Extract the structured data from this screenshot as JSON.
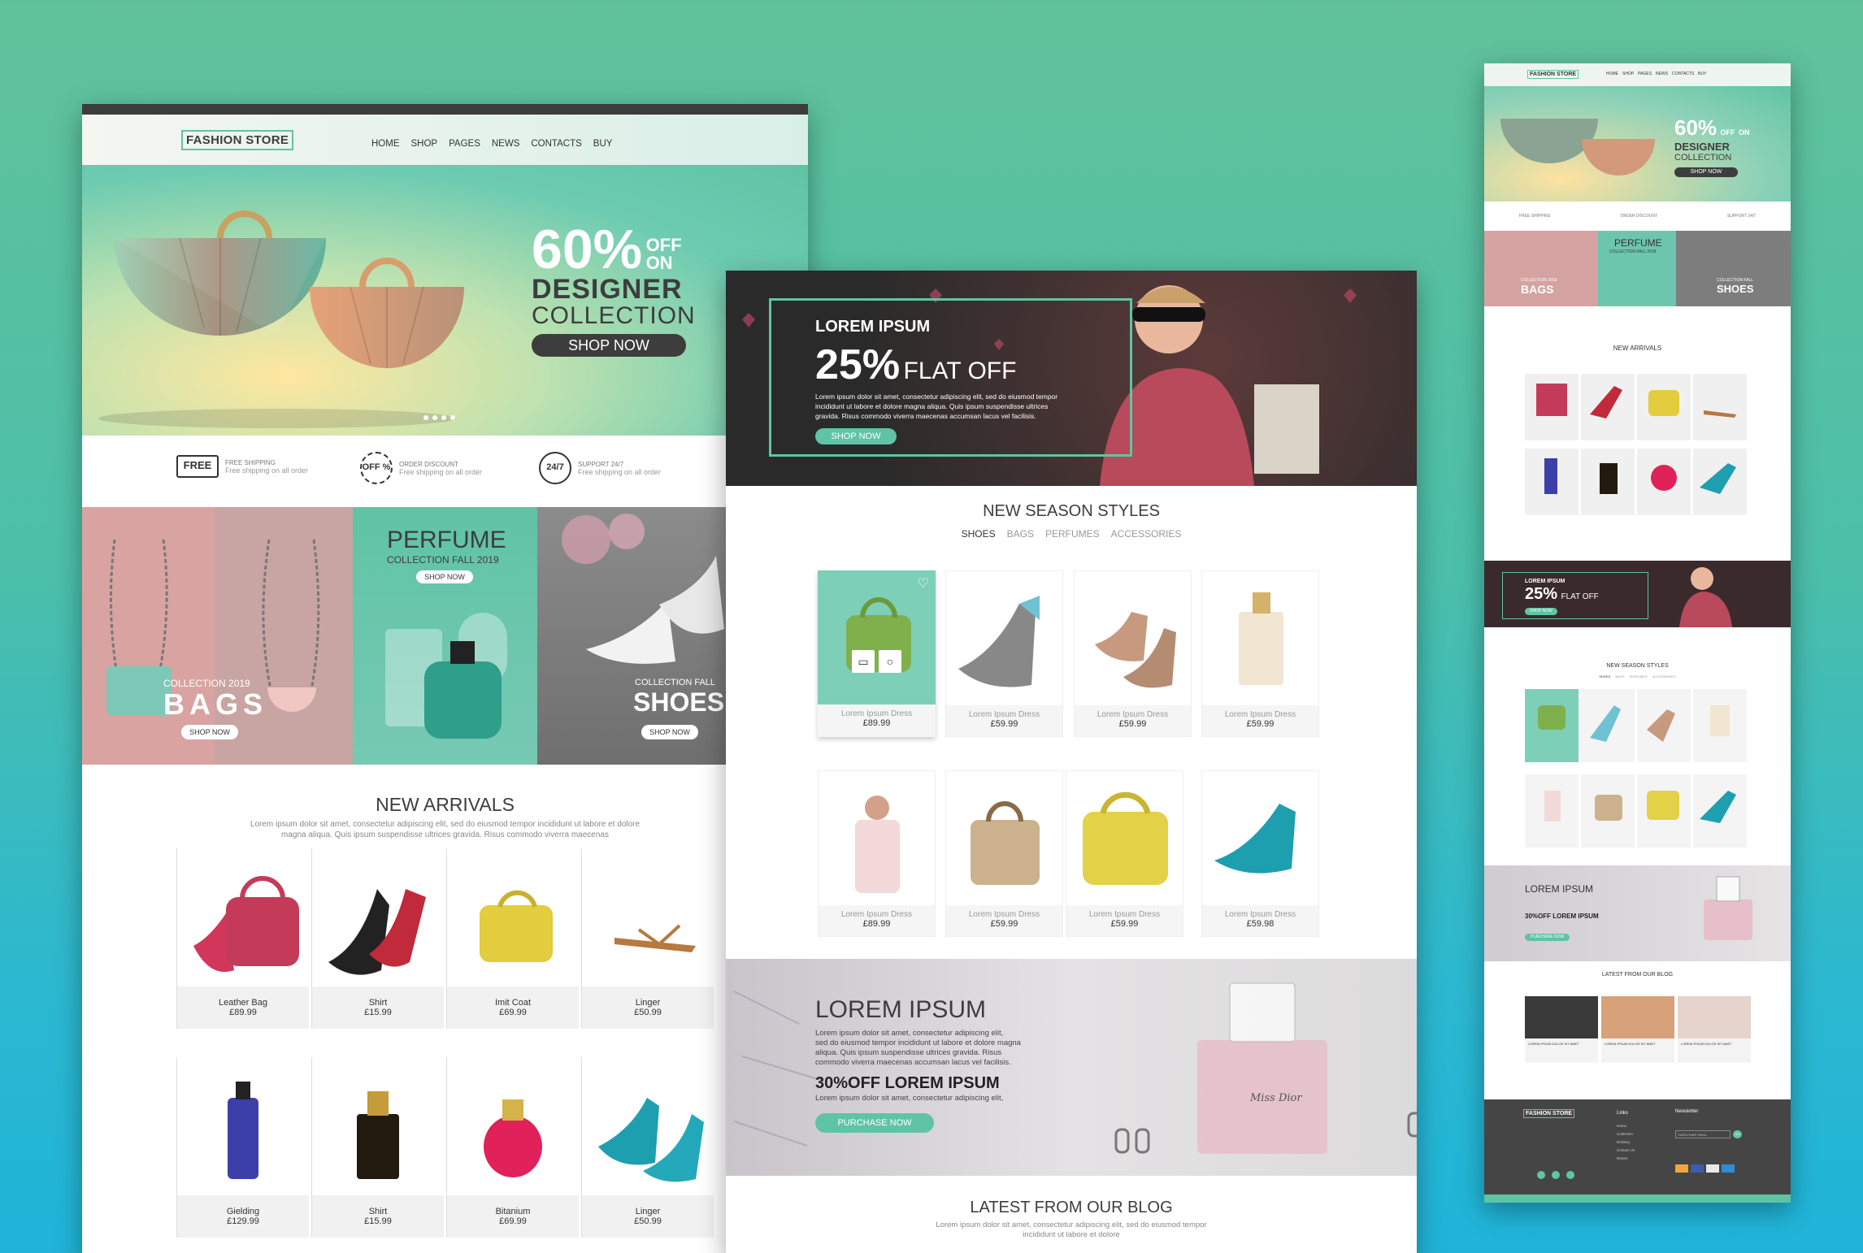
{
  "colors": {
    "accent": "#5fc4a4",
    "dark": "#3d3d3d",
    "topbar": "#3c3c3c",
    "pink": "#d6a3a1",
    "teal": "#62c6ad",
    "footer": "#454545"
  },
  "left": {
    "logo": "FASHION STORE",
    "nav": [
      "HOME",
      "SHOP",
      "PAGES",
      "NEWS",
      "CONTACTS",
      "BUY"
    ],
    "hero": {
      "pct": "60%",
      "off_top": "OFF",
      "off_bottom": "ON",
      "line1": "DESIGNER",
      "line2": "COLLECTION",
      "button": "SHOP NOW"
    },
    "features": [
      {
        "icon": "FREE",
        "title": "FREE SHIPPING",
        "sub": "Free shipping on all order"
      },
      {
        "icon": "OFF %",
        "title": "ORDER DISCOUNT",
        "sub": "Free shipping on all order"
      },
      {
        "icon": "24/7",
        "title": "SUPPORT 24/7",
        "sub": "Free shipping on all order"
      }
    ],
    "promos": {
      "bags": {
        "sub": "COLLECTION 2019",
        "title": "BAGS",
        "button": "SHOP NOW"
      },
      "perfume": {
        "title": "PERFUME",
        "sub": "COLLECTION FALL 2019",
        "button": "SHOP NOW"
      },
      "shoes": {
        "sub": "COLLECTION FALL",
        "title": "SHOES",
        "button": "SHOP NOW"
      }
    },
    "arrivals": {
      "title": "NEW ARRIVALS",
      "desc1": "Lorem ipsum dolor sit amet, consectetur adipiscing elit, sed do eiusmod tempor incididunt ut labore et dolore",
      "desc2": "magna aliqua. Quis ipsum suspendisse ultrices gravida. Risus commodo viverra maecenas",
      "row1": [
        {
          "name": "Leather Bag",
          "price": "£89.99"
        },
        {
          "name": "Shirt",
          "price": "£15.99"
        },
        {
          "name": "Imit Coat",
          "price": "£69.99"
        },
        {
          "name": "Linger",
          "price": "£50.99"
        }
      ],
      "row2": [
        {
          "name": "Gielding",
          "price": "£129.99"
        },
        {
          "name": "Shirt",
          "price": "£15.99"
        },
        {
          "name": "Bitanium",
          "price": "£69.99"
        },
        {
          "name": "Linger",
          "price": "£50.99"
        }
      ]
    }
  },
  "middle": {
    "banner": {
      "kicker": "LOREM IPSUM",
      "pct": "25%",
      "flat": "FLAT OFF",
      "text1": "Lorem ipsum dolor sit amet, consectetur adipiscing elit, sed do eiusmod tempor",
      "text2": "incididunt ut labore et dolore magna aliqua. Quis ipsum suspendisse ultrices",
      "text3": "gravida. Risus commodo viverra maecenas accumsan lacus vel facilisis.",
      "button": "SHOP NOW"
    },
    "season": {
      "title": "NEW SEASON STYLES",
      "tabs": [
        "SHOES",
        "BAGS",
        "PERFUMES",
        "ACCESSORIES"
      ],
      "row1": [
        {
          "name": "Lorem Ipsum Dress",
          "price": "£89.99"
        },
        {
          "name": "Lorem Ipsum Dress",
          "price": "£59.99"
        },
        {
          "name": "Lorem Ipsum Dress",
          "price": "£59.99"
        },
        {
          "name": "Lorem Ipsum Dress",
          "price": "£59.99"
        }
      ],
      "row2": [
        {
          "name": "Lorem Ipsum Dress",
          "price": "£89.99"
        },
        {
          "name": "Lorem Ipsum Dress",
          "price": "£59.99"
        },
        {
          "name": "Lorem Ipsum Dress",
          "price": "£59.99"
        },
        {
          "name": "Lorem Ipsum Dress",
          "price": "£59.98"
        }
      ]
    },
    "offer": {
      "title": "LOREM IPSUM",
      "text1": "Lorem ipsum dolor sit amet, consectetur adipiscing elit,",
      "text2": "sed do eiusmod tempor incididunt ut labore et dolore magna",
      "text3": "aliqua. Quis ipsum suspendisse ultrices gravida. Risus",
      "text4": "commodo viverra maecenas accumsan lacus vel facilisis.",
      "deal": "30%OFF LOREM IPSUM",
      "deal_sub": "Lorem ipsum dolor sit amet, consectetur adipiscing elit,",
      "button": "PURCHASE NOW",
      "perfume_label": "Miss Dior"
    },
    "blog": {
      "title": "LATEST FROM OUR BLOG",
      "text1": "Lorem ipsum dolor sit amet, consectetur adipiscing elit, sed do eiusmod tempor",
      "text2": "incididunt ut labore et dolore"
    }
  },
  "right": {
    "logo": "FASHION STORE",
    "nav": [
      "HOME",
      "SHOP",
      "PAGES",
      "NEWS",
      "CONTACTS",
      "BUY"
    ],
    "hero": {
      "pct": "60%",
      "off": "OFF",
      "on": "ON",
      "line1": "DESIGNER",
      "line2": "COLLECTION",
      "button": "SHOP NOW"
    },
    "features": [
      "FREE SHIPPING",
      "ORDER DISCOUNT",
      "SUPPORT 24/7"
    ],
    "promos": {
      "bags_sub": "COLLECTION 2019",
      "bags": "BAGS",
      "perfume": "PERFUME",
      "perfume_sub": "COLLECTION FALL 2019",
      "shoes_sub": "COLLECTION FALL",
      "shoes": "SHOES",
      "button": "SHOP NOW"
    },
    "arrivals": "NEW ARRIVALS",
    "banner": {
      "kicker": "LOREM IPSUM",
      "pct": "25%",
      "flat": "FLAT OFF",
      "button": "SHOP NOW"
    },
    "season": {
      "title": "NEW SEASON STYLES",
      "tabs": [
        "SHOES",
        "BAGS",
        "PERFUMES",
        "ACCESSORIES"
      ]
    },
    "offer": {
      "title": "LOREM IPSUM",
      "deal": "30%OFF LOREM IPSUM",
      "button": "PURCHASE NOW"
    },
    "blog": {
      "title": "LATEST FROM OUR BLOG",
      "post": "LOREM IPSUM DOLOR SIT AMET"
    },
    "footer": {
      "logo": "FASHION STORE",
      "col2": "Links",
      "col3": "Newsletter",
      "links": [
        "Home",
        "Collection",
        "Delivery",
        "Contact Us",
        "Return"
      ],
      "subscribe": "SUBSCRIBE EMAIL",
      "go": "GO"
    }
  }
}
